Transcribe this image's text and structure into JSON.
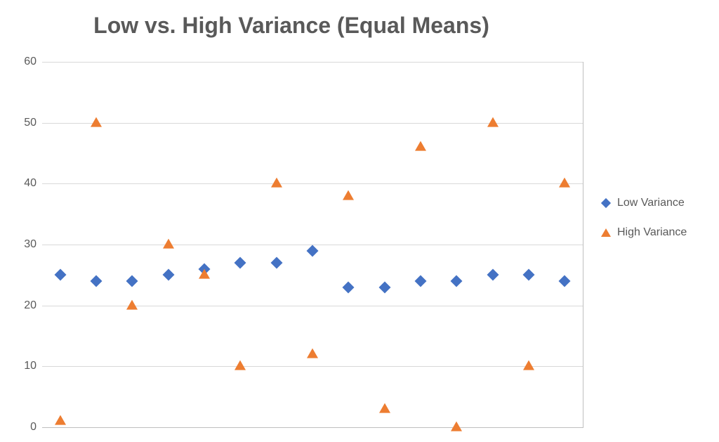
{
  "chart_data": {
    "type": "scatter",
    "title": "Low vs. High Variance (Equal Means)",
    "xlabel": "",
    "ylabel": "",
    "ylim": [
      0,
      60
    ],
    "yticks": [
      0,
      10,
      20,
      30,
      40,
      50,
      60
    ],
    "x": [
      1,
      2,
      3,
      4,
      5,
      6,
      7,
      8,
      9,
      10,
      11,
      12,
      13,
      14
    ],
    "series": [
      {
        "name": "Low Variance",
        "marker": "diamond",
        "color": "#4472c4",
        "values": [
          25,
          24,
          24,
          25,
          26,
          27,
          27,
          29,
          23,
          23,
          24,
          24,
          25,
          25,
          24
        ]
      },
      {
        "name": "High Variance",
        "marker": "triangle",
        "color": "#ed7d31",
        "values": [
          1,
          50,
          20,
          30,
          25,
          10,
          40,
          12,
          38,
          3,
          46,
          0,
          50,
          10,
          40
        ]
      }
    ],
    "legend_position": "right",
    "grid": true
  }
}
